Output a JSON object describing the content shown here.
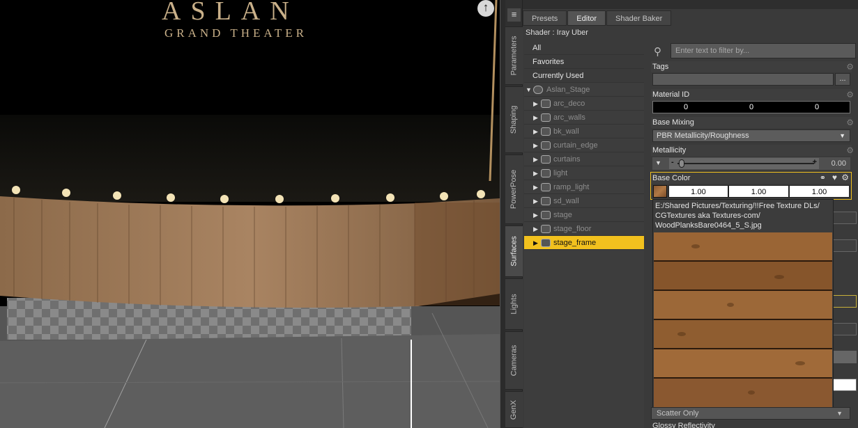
{
  "viewport": {
    "title_line1": "ASLAN",
    "title_line2": "GRAND THEATER",
    "up_icon": "arrow-up-circle-icon"
  },
  "side_tabs": [
    "Parameters",
    "Shaping",
    "PowerPose",
    "Surfaces",
    "Lights",
    "Cameras",
    "GenX"
  ],
  "side_tabs_active": "Surfaces",
  "panel": {
    "tabs": [
      "Presets",
      "Editor",
      "Shader Baker"
    ],
    "active_tab": "Editor",
    "shader_label": "Shader : Iray Uber"
  },
  "tree": {
    "categories": [
      "All",
      "Favorites",
      "Currently Used"
    ],
    "root": "Aslan_Stage",
    "children": [
      "arc_deco",
      "arc_walls",
      "bk_wall",
      "curtain_edge",
      "curtains",
      "light",
      "ramp_light",
      "sd_wall",
      "stage",
      "stage_floor",
      "stage_frame"
    ],
    "selected": "stage_frame"
  },
  "props": {
    "filter_placeholder": "Enter text to filter by...",
    "tags_label": "Tags",
    "tags_button": "...",
    "material_id_label": "Material ID",
    "material_id_values": [
      "0",
      "0",
      "0"
    ],
    "base_mixing_label": "Base Mixing",
    "base_mixing_value": "PBR Metallicity/Roughness",
    "metallicity_label": "Metallicity",
    "metallicity_minus": "-",
    "metallicity_plus": "+",
    "metallicity_value": "0.00",
    "metallicity_level": 0.0,
    "base_color_label": "Base Color",
    "base_color_values": [
      "1.00",
      "1.00",
      "1.00"
    ],
    "scatter_value": "Scatter Only",
    "glossy_label": "Glossy Reflectivity"
  },
  "tooltip": {
    "path": "E:/Shared Pictures/Texturing/!!Free Texture DLs/ CGTextures aka Textures-com/ WoodPlanksBare0464_5_S.jpg"
  },
  "colors": {
    "accent": "#f2c11e",
    "panel_bg": "#3a3a3a",
    "title_gold": "#c9b089"
  }
}
